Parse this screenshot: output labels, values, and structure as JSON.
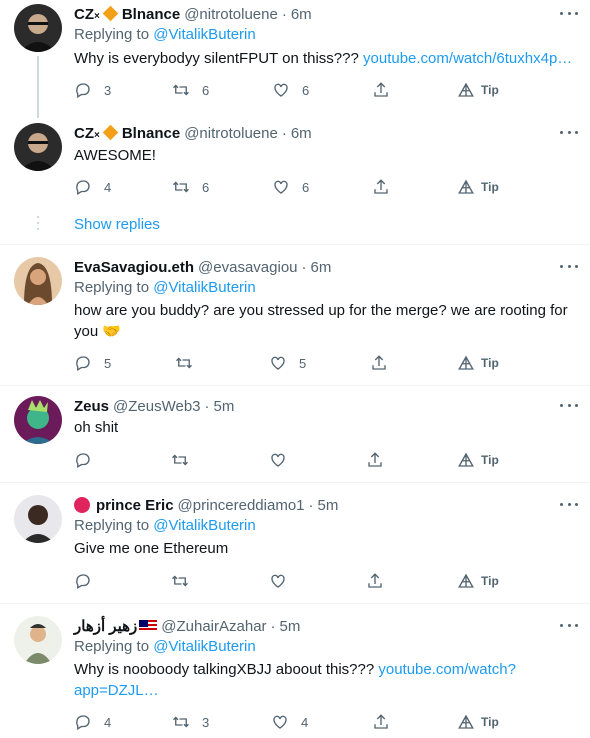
{
  "colors": {
    "accent": "#1d9bf0",
    "muted": "#536471",
    "text": "#0f1419",
    "divider": "#eff3f4"
  },
  "more_icon": "more-horizontal-icon",
  "action_icons": [
    "reply-icon",
    "retweet-icon",
    "like-icon",
    "share-icon",
    "tip-icon"
  ],
  "tip_label": "Tip",
  "show_replies": "Show replies",
  "tweets": [
    {
      "name_prefix": "CZ",
      "name_suffix": "Blnance",
      "handle": "@nitrotoluene",
      "time": "6m",
      "replying_label": "Replying to",
      "replying_to": "@VitalikButerin",
      "text": "Why is everybodyy silentFPUT on thiss???",
      "link": "youtube.com/watch/6tuxhx4p…",
      "replies": "3",
      "retweets": "6",
      "likes": "6"
    },
    {
      "name_prefix": "CZ",
      "name_suffix": "Blnance",
      "handle": "@nitrotoluene",
      "time": "6m",
      "text": "AWESOME!",
      "replies": "4",
      "retweets": "6",
      "likes": "6"
    },
    {
      "name": "EvaSavagiou.eth",
      "handle": "@evasavagiou",
      "time": "6m",
      "replying_label": "Replying to",
      "replying_to": "@VitalikButerin",
      "text_line1": "how are you buddy? are you stressed up for the merge? we are rooting for",
      "text_line2": "you 🤝",
      "replies": "5",
      "retweets": "",
      "likes": "5"
    },
    {
      "name": "Zeus",
      "handle": "@ZeusWeb3",
      "time": "5m",
      "text": "oh shit",
      "replies": "",
      "retweets": "",
      "likes": ""
    },
    {
      "name": "prince Eric",
      "handle": "@princereddiamo1",
      "time": "5m",
      "replying_label": "Replying to",
      "replying_to": "@VitalikButerin",
      "text": "Give me one Ethereum",
      "replies": "",
      "retweets": "",
      "likes": ""
    },
    {
      "name": "زهير أزهار",
      "handle": "@ZuhairAzahar",
      "time": "5m",
      "replying_label": "Replying to",
      "replying_to": "@VitalikButerin",
      "text": "Why is nooboody talkingXBJJ aboout this???",
      "link_line1": "youtube.com/watch?",
      "link_line2": "app=DZJL…",
      "replies": "4",
      "retweets": "3",
      "likes": "4"
    }
  ]
}
